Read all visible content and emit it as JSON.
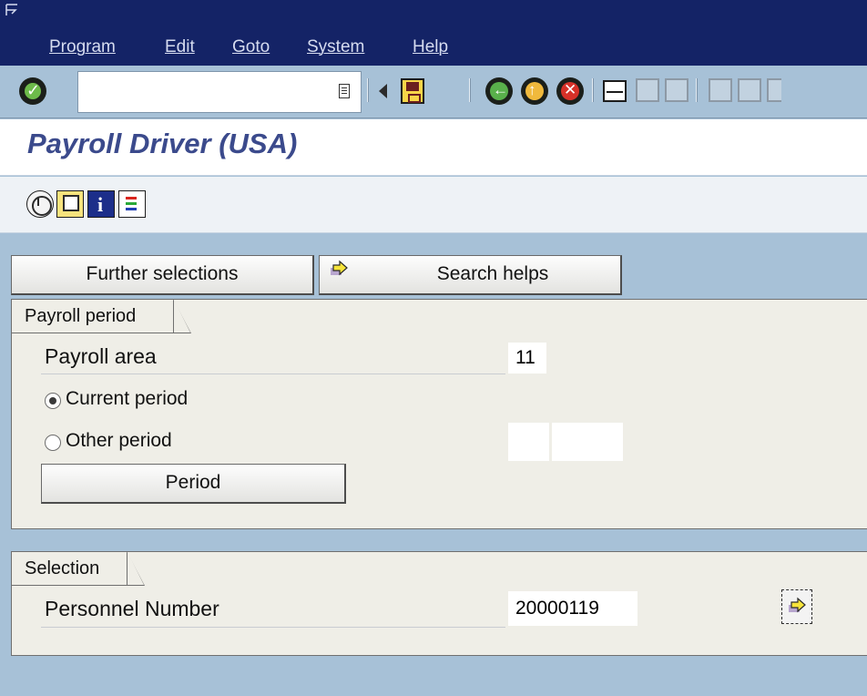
{
  "menu": {
    "items": [
      "Program",
      "Edit",
      "Goto",
      "System",
      "Help"
    ]
  },
  "toolbar": {
    "command_field_value": ""
  },
  "page": {
    "title": "Payroll Driver (USA)"
  },
  "buttons": {
    "further_selections": "Further selections",
    "search_helps": "Search helps",
    "period": "Period"
  },
  "payroll_period": {
    "group_title": "Payroll period",
    "payroll_area_label": "Payroll area",
    "payroll_area_value": "11",
    "current_period_label": "Current period",
    "other_period_label": "Other period",
    "selected_option": "Current period",
    "other_period_value_1": "",
    "other_period_value_2": ""
  },
  "selection": {
    "group_title": "Selection",
    "personnel_number_label": "Personnel Number",
    "personnel_number_value": "20000119"
  },
  "icons": {
    "enter": "checkmark-icon",
    "save": "floppy-disk-icon",
    "back": "back-arrow-icon",
    "exit": "exit-icon",
    "cancel": "cancel-icon",
    "print": "print-icon",
    "find": "binoculars-icon",
    "execute": "clock-execute-icon",
    "variant": "get-variant-icon",
    "info": "info-icon",
    "layout": "layout-icon",
    "arrow": "yellow-arrow-icon"
  },
  "colors": {
    "menu_bar": "#142366",
    "background": "#a7c1d7",
    "title_text": "#3b4a8c",
    "group_background": "#efeee7"
  }
}
